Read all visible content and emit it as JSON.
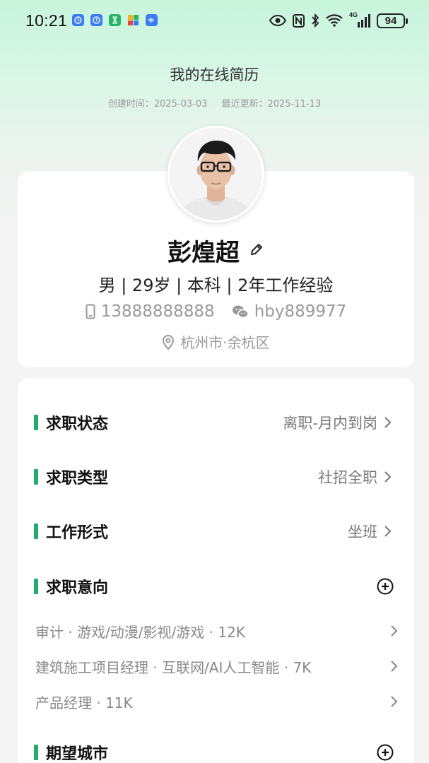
{
  "status_bar": {
    "time": "10:21",
    "battery": "94",
    "network": "4G"
  },
  "header": {
    "title": "我的在线简历",
    "created_label": "创建时间：",
    "created_date": "2025-03-03",
    "updated_label": "最近更新：",
    "updated_date": "2025-11-13"
  },
  "profile": {
    "name": "彭煌超",
    "basic_info": "男 | 29岁 | 本科 | 2年工作经验",
    "phone": "13888888888",
    "wechat": "hby889977",
    "location": "杭州市·余杭区"
  },
  "sections": {
    "job_status": {
      "title": "求职状态",
      "value": "离职-月内到岗"
    },
    "job_type": {
      "title": "求职类型",
      "value": "社招全职"
    },
    "work_mode": {
      "title": "工作形式",
      "value": "坐班"
    },
    "job_intention": {
      "title": "求职意向",
      "items": [
        "审计 · 游戏/动漫/影视/游戏 · 12K",
        "建筑施工项目经理 · 互联网/AI人工智能 · 7K",
        "产品经理 · 11K"
      ]
    },
    "expected_city": {
      "title": "期望城市"
    }
  },
  "colors": {
    "accent": "#1fae6e",
    "muted_text": "#999999"
  }
}
